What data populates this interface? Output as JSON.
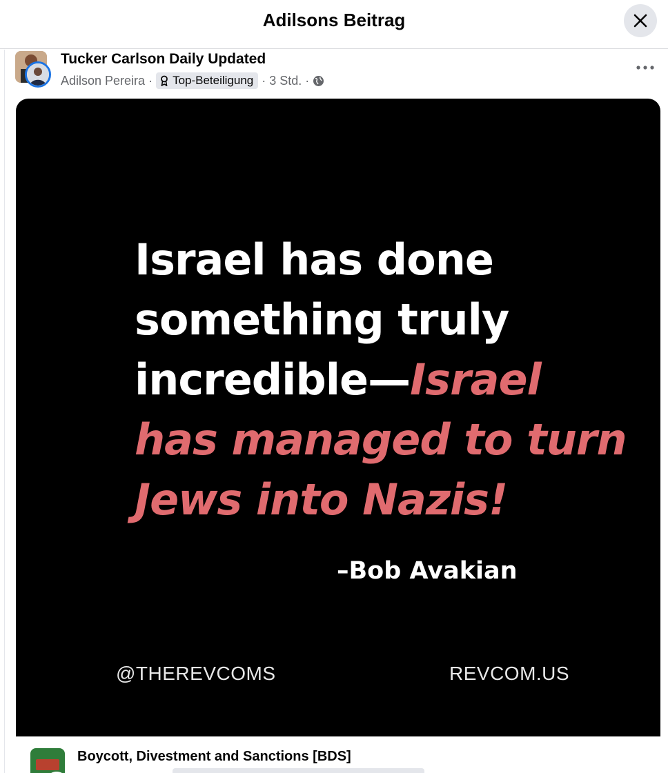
{
  "dialog": {
    "title": "Adilsons Beitrag",
    "close_icon": "close-icon"
  },
  "post": {
    "group_name": "Tucker Carlson Daily Updated",
    "author": "Adilson Pereira",
    "badge_label": "Top-Beteiligung",
    "badge_icon": "award-icon",
    "time": "3 Std.",
    "audience_icon": "globe-icon",
    "more_icon": "more-icon",
    "image": {
      "quote_white": "Israel has done something truly incredible—",
      "quote_red": "Israel has managed to turn Jews into Nazis!",
      "attribution": "–Bob Avakian",
      "handle": "@THEREVCOMS",
      "site": "REVCOM.US",
      "colors": {
        "background": "#000000",
        "text": "#ffffff",
        "highlight": "#e06b6f"
      }
    }
  },
  "next_post": {
    "group_name": "Boycott, Divestment and Sanctions [BDS]"
  }
}
